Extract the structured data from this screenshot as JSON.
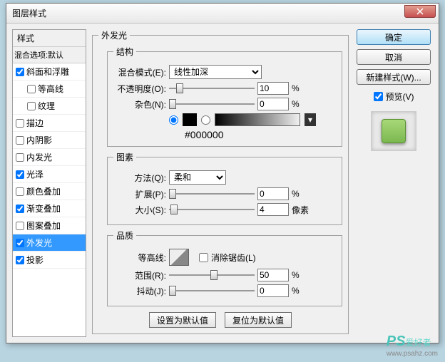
{
  "window": {
    "title": "图层样式"
  },
  "sidebar": {
    "header": "样式",
    "sub": "混合选项:默认",
    "items": [
      {
        "label": "斜面和浮雕",
        "checked": true,
        "indent": false
      },
      {
        "label": "等高线",
        "checked": false,
        "indent": true
      },
      {
        "label": "纹理",
        "checked": false,
        "indent": true
      },
      {
        "label": "描边",
        "checked": false,
        "indent": false
      },
      {
        "label": "内阴影",
        "checked": false,
        "indent": false
      },
      {
        "label": "内发光",
        "checked": false,
        "indent": false
      },
      {
        "label": "光泽",
        "checked": true,
        "indent": false
      },
      {
        "label": "颜色叠加",
        "checked": false,
        "indent": false
      },
      {
        "label": "渐变叠加",
        "checked": true,
        "indent": false
      },
      {
        "label": "图案叠加",
        "checked": false,
        "indent": false
      },
      {
        "label": "外发光",
        "checked": true,
        "indent": false,
        "selected": true
      },
      {
        "label": "投影",
        "checked": true,
        "indent": false
      }
    ]
  },
  "main": {
    "title": "外发光",
    "structure": {
      "legend": "结构",
      "blend_label": "混合模式(E):",
      "blend_value": "线性加深",
      "opacity_label": "不透明度(O):",
      "opacity_value": "10",
      "opacity_unit": "%",
      "noise_label": "杂色(N):",
      "noise_value": "0",
      "noise_unit": "%",
      "hex": "#000000"
    },
    "elements": {
      "legend": "图素",
      "method_label": "方法(Q):",
      "method_value": "柔和",
      "spread_label": "扩展(P):",
      "spread_value": "0",
      "spread_unit": "%",
      "size_label": "大小(S):",
      "size_value": "4",
      "size_unit": "像素"
    },
    "quality": {
      "legend": "品质",
      "contour_label": "等高线:",
      "antialias_label": "消除锯齿(L)",
      "range_label": "范围(R):",
      "range_value": "50",
      "range_unit": "%",
      "jitter_label": "抖动(J):",
      "jitter_value": "0",
      "jitter_unit": "%"
    },
    "buttons": {
      "default": "设置为默认值",
      "reset": "复位为默认值"
    }
  },
  "right": {
    "ok": "确定",
    "cancel": "取消",
    "newstyle": "新建样式(W)...",
    "preview": "预览(V)"
  },
  "watermark": {
    "brand": "PS",
    "text": "爱好者",
    "url": "www.psahz.com"
  }
}
